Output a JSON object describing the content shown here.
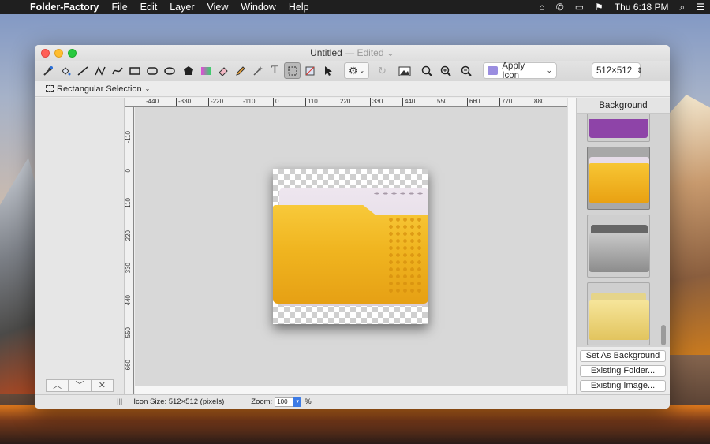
{
  "menubar": {
    "apple": "",
    "app_name": "Folder-Factory",
    "items": [
      "File",
      "Edit",
      "Layer",
      "View",
      "Window",
      "Help"
    ],
    "clock": "Thu 6:18 PM"
  },
  "window": {
    "title": "Untitled",
    "edited": "— Edited ⌄"
  },
  "toolbar": {
    "apply_label": "Apply Icon",
    "size_value": "512×512"
  },
  "options": {
    "selection_mode": "Rectangular Selection"
  },
  "rulers": {
    "h_ticks": [
      "-440",
      "-330",
      "-220",
      "-110",
      "0",
      "110",
      "220",
      "330",
      "440",
      "550",
      "660",
      "770",
      "880"
    ],
    "v_ticks": [
      "-110",
      "0",
      "110",
      "220",
      "330",
      "440",
      "550",
      "660"
    ]
  },
  "right_panel": {
    "header": "Background",
    "set_background": "Set As Background",
    "existing_folder": "Existing Folder...",
    "existing_image": "Existing Image..."
  },
  "status": {
    "icon_size": "Icon Size: 512×512 (pixels)",
    "zoom_label": "Zoom:",
    "zoom_value": "100",
    "zoom_unit": "%"
  },
  "colors": {
    "folder_yellow": "#f0b520",
    "folder_tab": "#e2d9e4",
    "purple_folder": "#8e44a8",
    "menubar_bg": "#1f1f1f"
  }
}
